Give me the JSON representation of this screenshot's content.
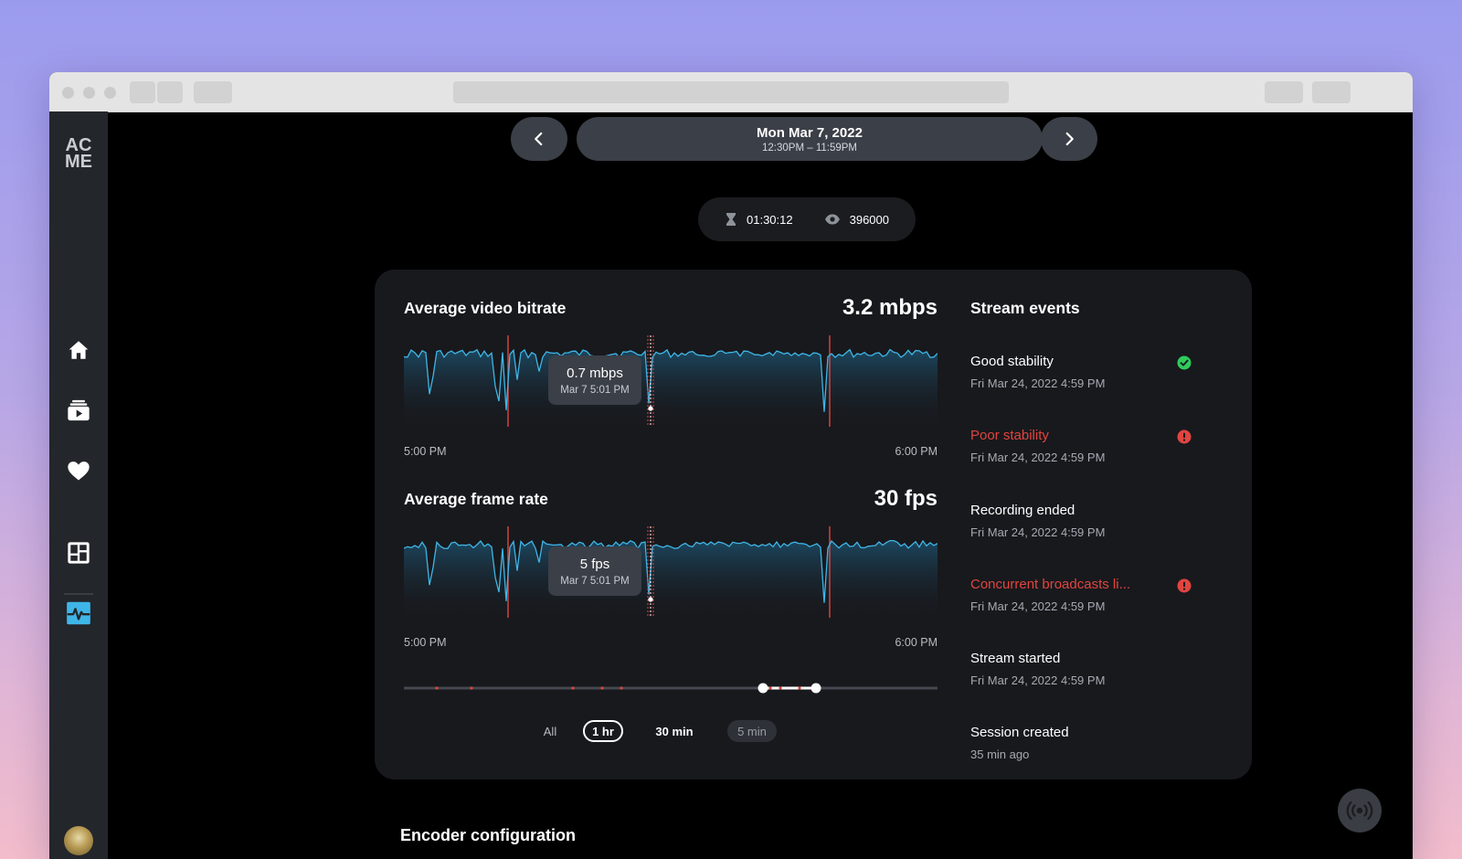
{
  "brand": {
    "logo_line1": "AC",
    "logo_line2": "ME"
  },
  "date_nav": {
    "title": "Mon Mar 7, 2022",
    "subtitle": "12:30PM – 11:59PM"
  },
  "stats": {
    "duration": "01:30:12",
    "viewers": "396000"
  },
  "sidebar": {
    "items": [
      {
        "icon": "home-icon"
      },
      {
        "icon": "video-library-icon"
      },
      {
        "icon": "heart-icon"
      },
      {
        "icon": "dashboard-icon"
      },
      {
        "icon": "activity-monitor-icon",
        "active": true
      }
    ]
  },
  "colors": {
    "accent": "#3fb6e8",
    "warning": "#e0453f",
    "success": "#2ecc5c",
    "card": "#18191d"
  },
  "charts": {
    "bitrate": {
      "title": "Average video bitrate",
      "value": "3.2 mbps",
      "tooltip_value": "0.7 mbps",
      "tooltip_date": "Mar 7 5:01 PM",
      "x_start": "5:00 PM",
      "x_end": "6:00 PM"
    },
    "framerate": {
      "title": "Average frame rate",
      "value": "30 fps",
      "tooltip_value": "5 fps",
      "tooltip_date": "Mar 7 5:01 PM",
      "x_start": "5:00 PM",
      "x_end": "6:00 PM"
    }
  },
  "range_tabs": {
    "all": "All",
    "one_hr": "1 hr",
    "thirty_min": "30 min",
    "five_min": "5 min",
    "selected": "1 hr"
  },
  "events": {
    "title": "Stream events",
    "items": [
      {
        "name": "Good stability",
        "time": "Fri Mar 24, 2022 4:59 PM",
        "status": "success"
      },
      {
        "name": "Poor stability",
        "time": "Fri Mar 24, 2022 4:59 PM",
        "status": "warning"
      },
      {
        "name": "Recording ended",
        "time": "Fri Mar 24, 2022 4:59 PM",
        "status": "neutral"
      },
      {
        "name": "Concurrent broadcasts li...",
        "time": "Fri Mar 24, 2022 4:59 PM",
        "status": "warning"
      },
      {
        "name": "Stream started",
        "time": "Fri Mar 24, 2022 4:59 PM",
        "status": "neutral"
      },
      {
        "name": "Session created",
        "time": "35 min ago",
        "status": "neutral"
      }
    ]
  },
  "section": {
    "encoder_title": "Encoder configuration"
  }
}
